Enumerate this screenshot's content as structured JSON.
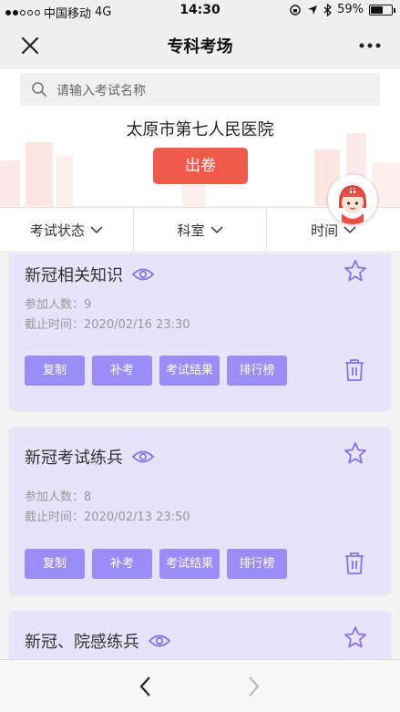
{
  "status_bar": {
    "carrier": "中国移动",
    "network": "4G",
    "time": "14:30",
    "battery_percent": "59%",
    "battery_level": 0.59
  },
  "navbar": {
    "title": "专科考场",
    "close_icon": "close-icon",
    "more_icon": "more-icon"
  },
  "search": {
    "placeholder": "请输入考试名称"
  },
  "hospital_name": "太原市第七人民医院",
  "create_exam_label": "出卷",
  "filters": [
    {
      "label": "考试状态"
    },
    {
      "label": "科室"
    },
    {
      "label": "时间"
    }
  ],
  "cards": [
    {
      "name": "新冠相关知识",
      "participants_label": "参加人数：",
      "participants": "9",
      "deadline_label": "截止时间：",
      "deadline": "2020/02/16 23:30"
    },
    {
      "name": "新冠考试练兵",
      "participants_label": "参加人数：",
      "participants": "8",
      "deadline_label": "截止时间：",
      "deadline": "2020/02/13 23:50"
    },
    {
      "name": "新冠、院感练兵"
    }
  ],
  "actions": {
    "copy": "复制",
    "retake": "补考",
    "results": "考试结果",
    "ranking": "排行榜"
  },
  "colors": {
    "accent": "#9b8cf6",
    "card_bg": "#e6e3fb",
    "primary_button": "#ef5a4b"
  }
}
